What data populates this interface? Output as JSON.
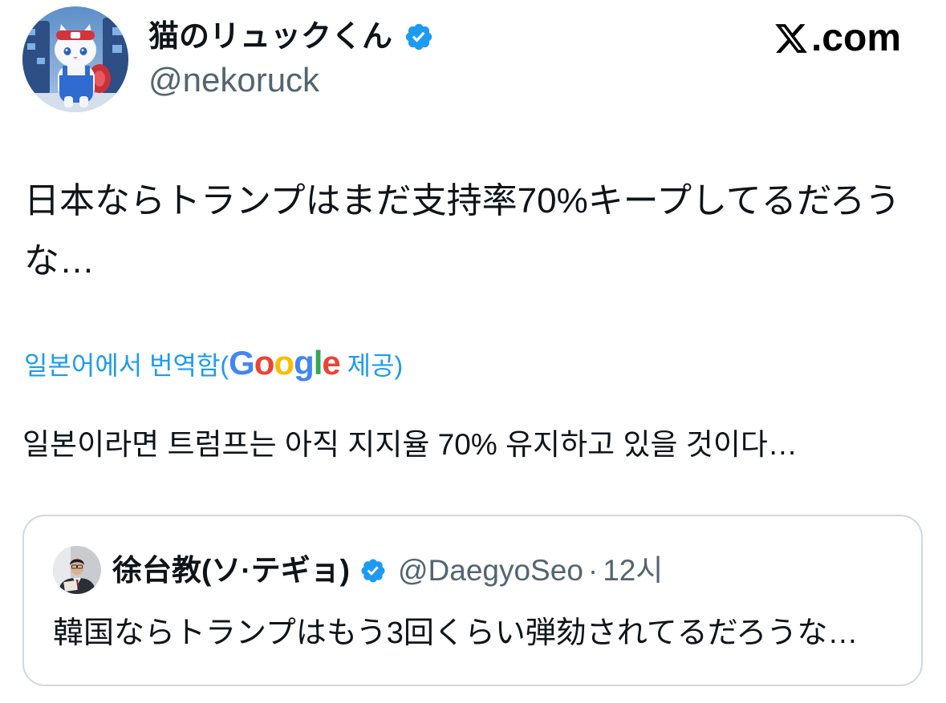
{
  "tweet": {
    "author": {
      "avatar_icon": "cat-backpack-avatar",
      "display_name": "猫のリュックくん",
      "verified_icon": "verified-badge-icon",
      "handle": "@nekoruck"
    },
    "text": "日本ならトランプはまだ支持率70%キープしてるだろうな…",
    "translation": {
      "label_prefix": "일본어에서 번역함(",
      "provider_logo_letters": [
        {
          "char": "G",
          "color": "#4285F4"
        },
        {
          "char": "o",
          "color": "#EA4335"
        },
        {
          "char": "o",
          "color": "#FBBC05"
        },
        {
          "char": "g",
          "color": "#4285F4"
        },
        {
          "char": "l",
          "color": "#34A853"
        },
        {
          "char": "e",
          "color": "#EA4335"
        }
      ],
      "label_suffix": " 제공)",
      "text": "일본이라면 트럼프는 아직 지지율 70% 유지하고 있을 것이다…"
    },
    "quoted_tweet": {
      "author": {
        "avatar_icon": "person-photo-avatar",
        "display_name": "徐台教(ソ·テギョ)",
        "verified_icon": "verified-badge-icon",
        "handle": "@DaegyoSeo"
      },
      "separator": "·",
      "time": "12시",
      "text": "韓国ならトランプはもう3回くらい弾劾されてるだろうな…"
    }
  },
  "watermark": {
    "logo_icon": "x-logo-icon",
    "domain_suffix": ".com"
  },
  "colors": {
    "primary_text": "#0f1419",
    "secondary_text": "#536471",
    "link": "#1d9bf0",
    "verified_badge": "#1d9bf0",
    "card_border": "#cfd9de",
    "background": "#ffffff"
  }
}
